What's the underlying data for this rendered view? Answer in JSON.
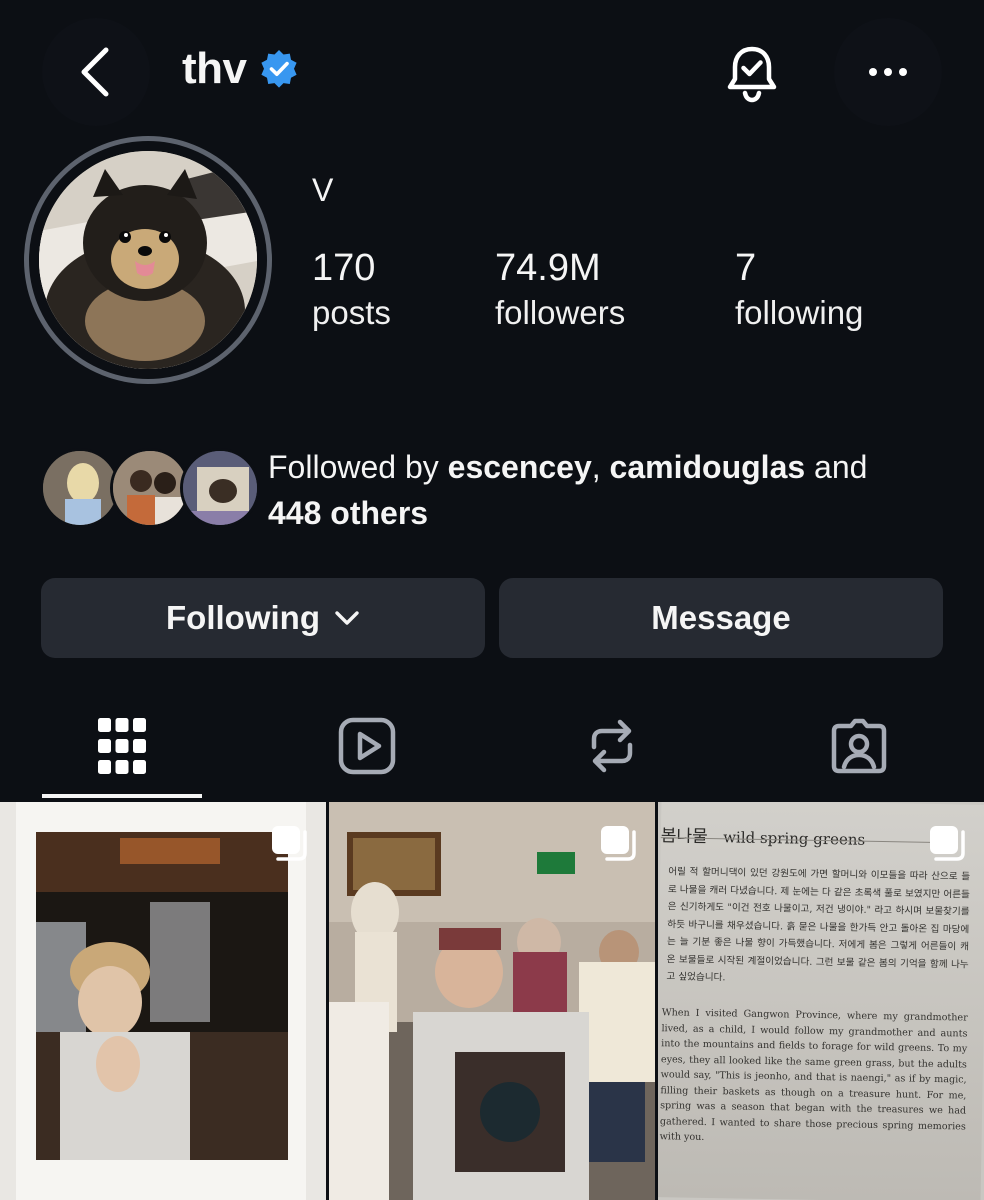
{
  "header": {
    "username": "thv",
    "back_icon": "chevron-left-icon",
    "verified_icon": "verified-badge-icon",
    "bell_icon": "bell-check-icon",
    "more_icon": "more-horizontal-icon"
  },
  "profile": {
    "display_name": "V",
    "stats": [
      {
        "value": "170",
        "label": "posts"
      },
      {
        "value": "74.9M",
        "label": "followers"
      },
      {
        "value": "7",
        "label": "following"
      }
    ]
  },
  "followed_by": {
    "prefix": "Followed by ",
    "user1": "escencey",
    "sep": ", ",
    "user2": "camidouglas",
    "and": " and",
    "others": "448 others"
  },
  "buttons": {
    "following": "Following",
    "message": "Message"
  },
  "tabs": [
    {
      "icon": "grid-icon",
      "active": true
    },
    {
      "icon": "reels-icon",
      "active": false
    },
    {
      "icon": "reposts-icon",
      "active": false
    },
    {
      "icon": "tagged-icon",
      "active": false
    }
  ],
  "posts": {
    "post3": {
      "title_ko": "봄나물",
      "title_en": "wild spring greens",
      "text_ko": "어릴 적 할머니댁이 있던 강원도에 가면 할머니와 이모들을 따라 산으로 들로 나물을 캐러 다녔습니다. 제 눈에는 다 같은 초록색 풀로 보였지만 어른들은 신기하게도 \"이건 전호 나물이고, 저건 냉이야.\" 라고 하시며 보물찾기를 하듯 바구니를 채우셨습니다. 흙 묻은 나물을 한가득 안고 돌아온 집 마당에는 늘 기분 좋은 나물 향이 가득했습니다. 저에게 봄은 그렇게 어른들이 캐 온 보물들로 시작된 계절이었습니다. 그런 보물 같은 봄의 기억을 함께 나누고 싶었습니다.",
      "text_en": "When I visited Gangwon Province, where my grandmother lived, as a child, I would follow my grandmother and aunts into the mountains and fields to forage for wild greens. To my eyes, they all looked like the same green grass, but the adults would say, \"This is jeonho, and that is naengi,\" as if by magic, filling their baskets as though on a treasure hunt. For me, spring was a season that began with the treasures we had gathered. I wanted to share those precious spring memories with you."
    }
  }
}
